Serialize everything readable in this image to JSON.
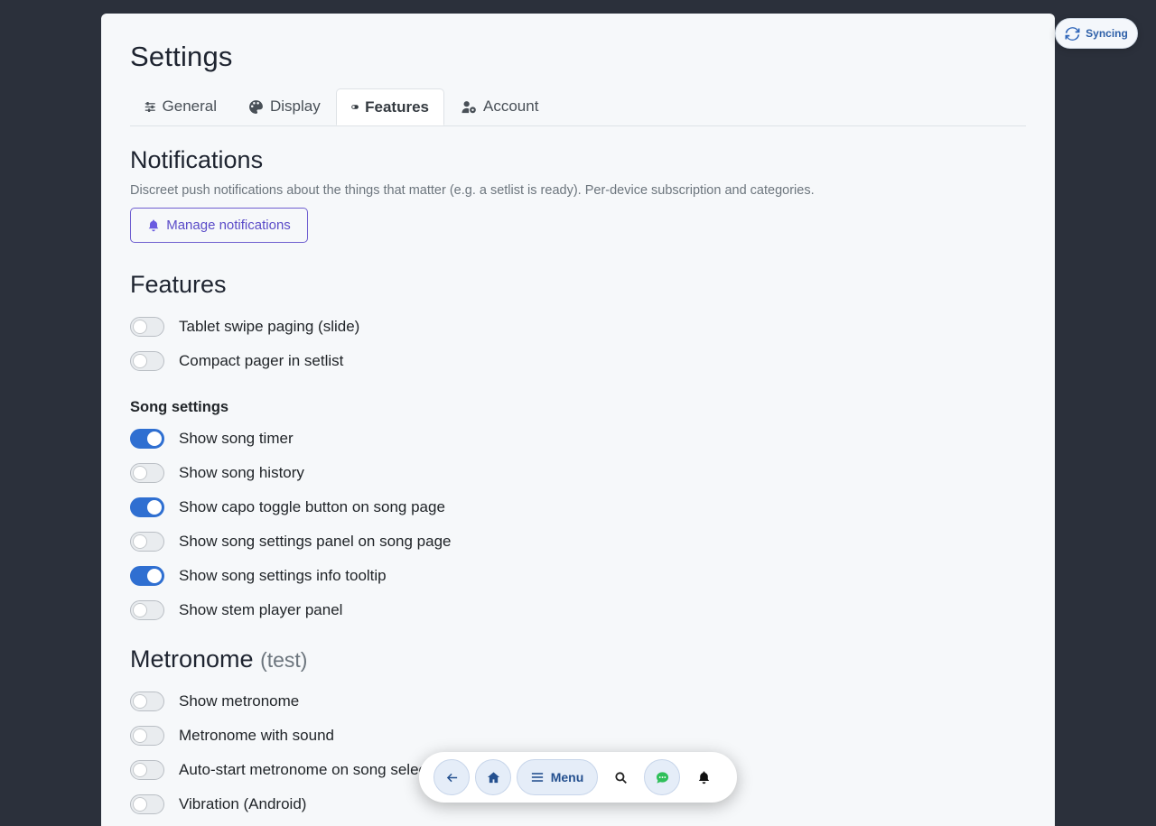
{
  "page": {
    "title": "Settings"
  },
  "tabs": [
    {
      "label": "General",
      "icon": "sliders-icon"
    },
    {
      "label": "Display",
      "icon": "palette-icon"
    },
    {
      "label": "Features",
      "icon": "toggle-icon",
      "active": true
    },
    {
      "label": "Account",
      "icon": "user-gear-icon"
    }
  ],
  "notifications": {
    "heading": "Notifications",
    "description": "Discreet push notifications about the things that matter (e.g. a setlist is ready). Per-device subscription and categories.",
    "manage_label": "Manage notifications"
  },
  "features": {
    "heading": "Features",
    "toggles": [
      {
        "label": "Tablet swipe paging (slide)",
        "on": false
      },
      {
        "label": "Compact pager in setlist",
        "on": false
      }
    ]
  },
  "song_settings": {
    "heading": "Song settings",
    "toggles": [
      {
        "label": "Show song timer",
        "on": true
      },
      {
        "label": "Show song history",
        "on": false
      },
      {
        "label": "Show capo toggle button on song page",
        "on": true
      },
      {
        "label": "Show song settings panel on song page",
        "on": false
      },
      {
        "label": "Show song settings info tooltip",
        "on": true
      },
      {
        "label": "Show stem player panel",
        "on": false
      }
    ]
  },
  "metronome": {
    "heading": "Metronome",
    "heading_suffix": "(test)",
    "toggles": [
      {
        "label": "Show metronome",
        "on": false
      },
      {
        "label": "Metronome with sound",
        "on": false
      },
      {
        "label": "Auto-start metronome on song selection",
        "on": false
      },
      {
        "label": "Vibration (Android)",
        "on": false
      }
    ]
  },
  "sync": {
    "label": "Syncing"
  },
  "bottom_nav": {
    "menu_label": "Menu"
  },
  "colors": {
    "accent": "#2f6fd1",
    "notify": "#5b4cc8",
    "chat": "#2fbf5a"
  }
}
